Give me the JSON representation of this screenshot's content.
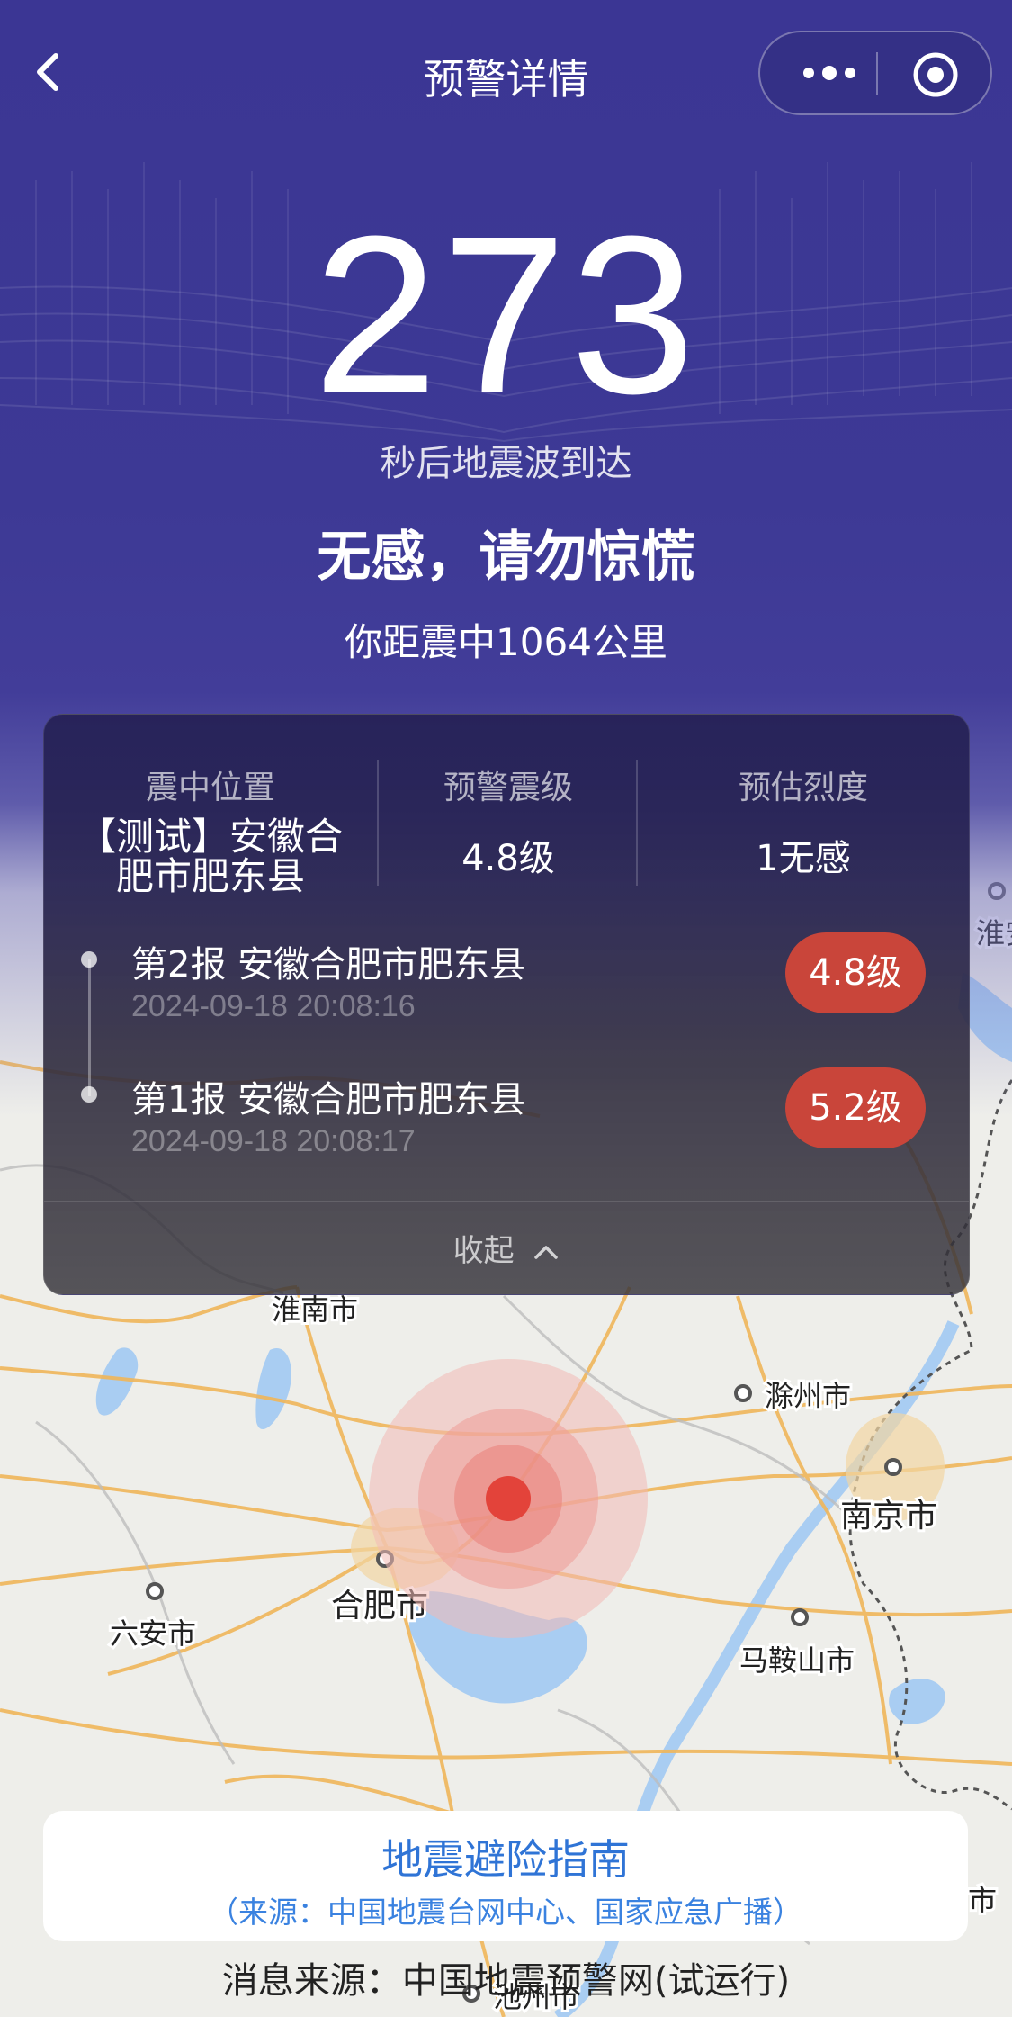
{
  "nav": {
    "title": "预警详情",
    "back_icon": "chevron-left-icon",
    "more_icon": "more-dots-icon",
    "close_icon": "target-circle-icon"
  },
  "hero": {
    "countdown": "273",
    "arrive_text": "秒后地震波到达",
    "feeling": "无感，请勿惊慌",
    "distance": "你距震中1064公里"
  },
  "panel": {
    "stats": [
      {
        "label": "震中位置",
        "value_line1": "【测试】安徽合",
        "value_line2": "肥市肥东县"
      },
      {
        "label": "预警震级",
        "value": "4.8级"
      },
      {
        "label": "预估烈度",
        "value": "1无感"
      }
    ],
    "reports": [
      {
        "title": "第2报  安徽合肥市肥东县",
        "time": "2024-09-18 20:08:16",
        "magnitude": "4.8级"
      },
      {
        "title": "第1报  安徽合肥市肥东县",
        "time": "2024-09-18 20:08:17",
        "magnitude": "5.2级"
      }
    ],
    "collapse_label": "收起"
  },
  "map": {
    "cities": [
      {
        "name": "淮南市"
      },
      {
        "name": "滁州市"
      },
      {
        "name": "南京市"
      },
      {
        "name": "合肥市"
      },
      {
        "name": "六安市"
      },
      {
        "name": "马鞍山市"
      },
      {
        "name": "淮安"
      },
      {
        "name": "池州市"
      },
      {
        "name": "市"
      }
    ]
  },
  "guide": {
    "title": "地震避险指南",
    "subtitle": "（来源：中国地震台网中心、国家应急广播）"
  },
  "footer": {
    "source": "消息来源：中国地震预警网(试运行)"
  },
  "colors": {
    "hero_bg": "#3b3694",
    "badge": "#c9453a",
    "epicenter": "#e3433a",
    "link_blue": "#2f74d6"
  }
}
